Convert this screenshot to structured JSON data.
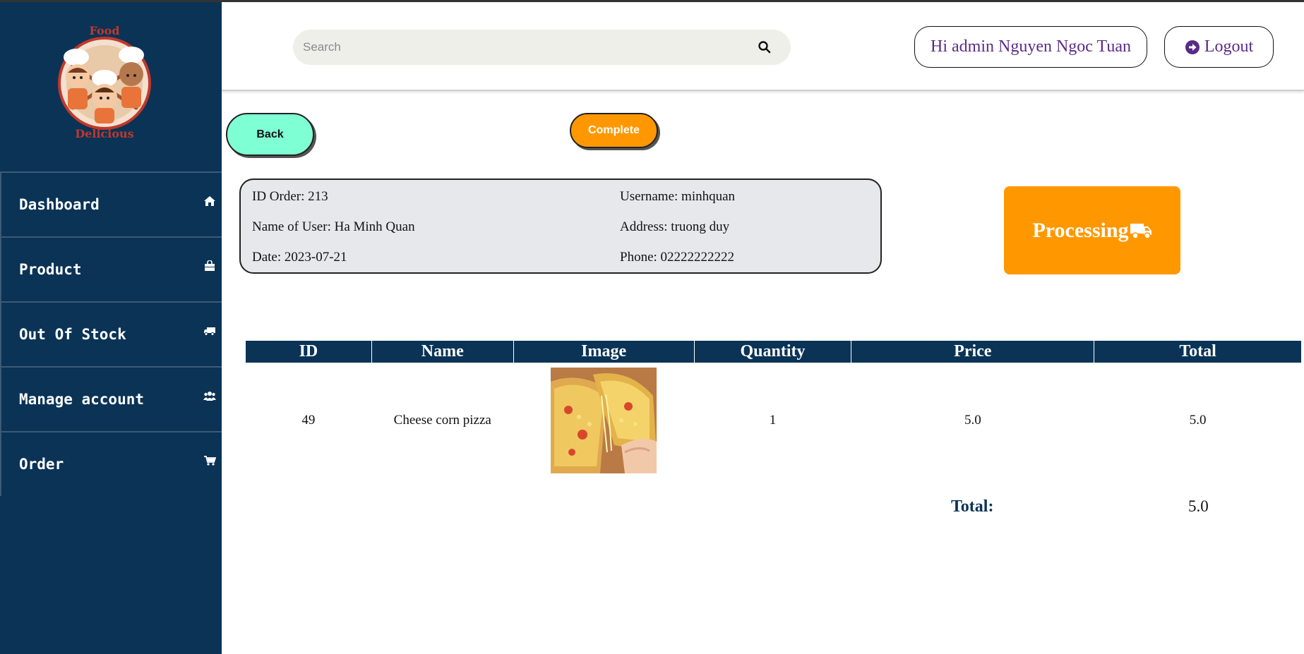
{
  "brand": {
    "logo_top_text": "Food",
    "logo_bottom_text": "Delicious"
  },
  "sidebar": {
    "items": [
      {
        "label": "Dashboard",
        "icon": "home-icon"
      },
      {
        "label": "Product",
        "icon": "shopping-bag-icon"
      },
      {
        "label": "Out Of Stock",
        "icon": "truck-icon"
      },
      {
        "label": "Manage account",
        "icon": "users-icon"
      },
      {
        "label": "Order",
        "icon": "cart-icon"
      }
    ]
  },
  "header": {
    "search_placeholder": "Search",
    "greeting": "Hi admin Nguyen Ngoc Tuan",
    "logout_label": "Logout"
  },
  "actions": {
    "back_label": "Back",
    "complete_label": "Complete"
  },
  "order": {
    "id_text": "ID Order: 213",
    "name_text": "Name of User: Ha Minh Quan",
    "date_text": "Date: 2023-07-21",
    "username_text": "Username: minhquan",
    "address_text": "Address: truong duy",
    "phone_text": "Phone: 02222222222",
    "status": "Processing"
  },
  "table": {
    "headers": [
      "ID",
      "Name",
      "Image",
      "Quantity",
      "Price",
      "Total"
    ],
    "rows": [
      {
        "id": "49",
        "name": "Cheese corn pizza",
        "image": "pizza-photo",
        "quantity": "1",
        "price": "5.0",
        "total": "5.0"
      }
    ]
  },
  "summary": {
    "total_label": "Total:",
    "total_value": "5.0"
  },
  "colors": {
    "sidebar_bg": "#0a3356",
    "accent_orange": "#ff9800",
    "back_button": "#7fffd4",
    "header_text": "#5b2b86"
  }
}
